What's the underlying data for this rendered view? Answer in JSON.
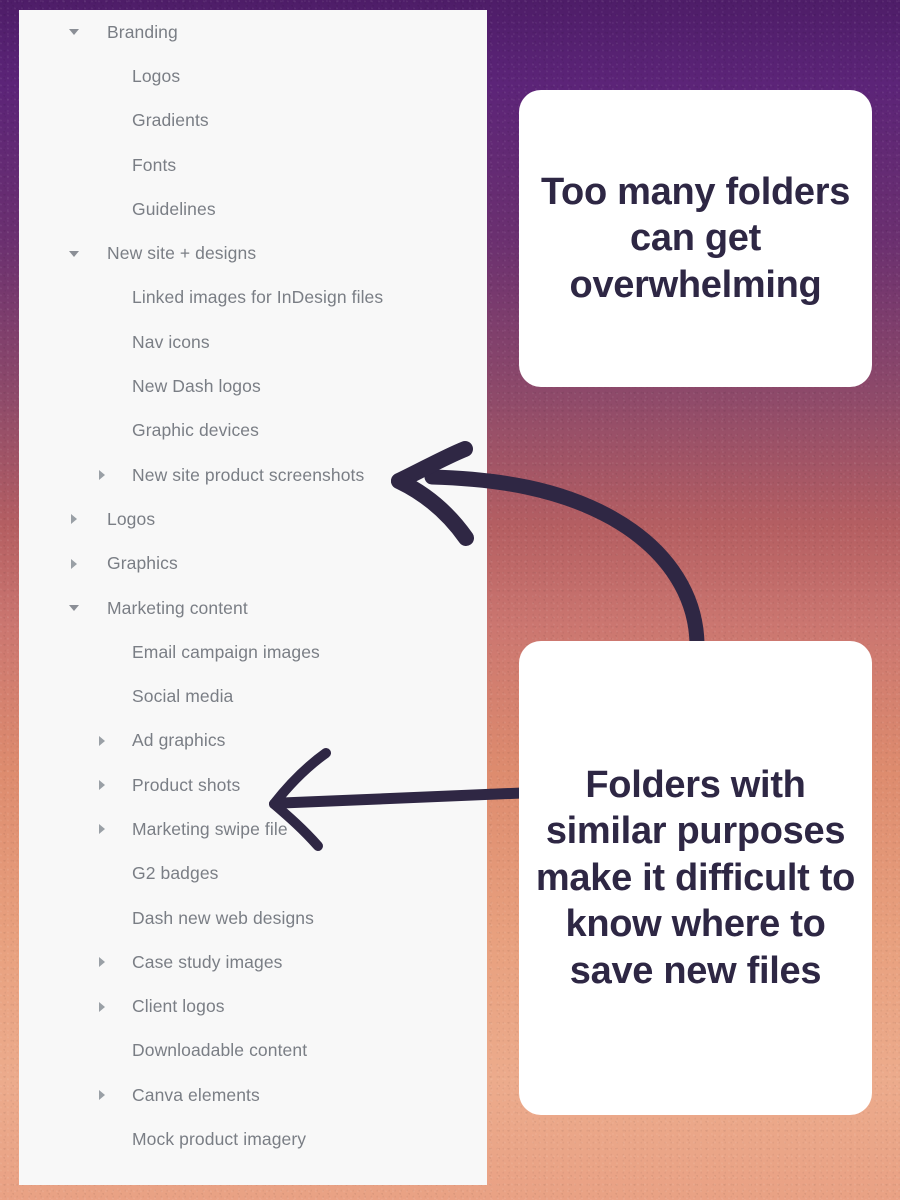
{
  "background": {
    "gradient_top_color": "#4e1d68",
    "gradient_mid_color": "#cb7670",
    "gradient_bottom_color": "#e9a184"
  },
  "panel": {
    "background_color": "#f8f8f8",
    "label_color": "#7a7e85"
  },
  "file_tree": {
    "items": [
      {
        "label": "Branding",
        "level": 1,
        "toggle": "expanded"
      },
      {
        "label": "Logos",
        "level": 2,
        "toggle": "none"
      },
      {
        "label": "Gradients",
        "level": 2,
        "toggle": "none"
      },
      {
        "label": "Fonts",
        "level": 2,
        "toggle": "none"
      },
      {
        "label": "Guidelines",
        "level": 2,
        "toggle": "none"
      },
      {
        "label": "New site + designs",
        "level": 1,
        "toggle": "expanded"
      },
      {
        "label": "Linked images for InDesign files",
        "level": 2,
        "toggle": "none"
      },
      {
        "label": "Nav icons",
        "level": 2,
        "toggle": "none"
      },
      {
        "label": "New Dash logos",
        "level": 2,
        "toggle": "none"
      },
      {
        "label": "Graphic devices",
        "level": 2,
        "toggle": "none"
      },
      {
        "label": "New site product screenshots",
        "level": 2,
        "toggle": "collapsed"
      },
      {
        "label": "Logos",
        "level": 1,
        "toggle": "collapsed"
      },
      {
        "label": "Graphics",
        "level": 1,
        "toggle": "collapsed"
      },
      {
        "label": "Marketing content",
        "level": 1,
        "toggle": "expanded"
      },
      {
        "label": "Email campaign images",
        "level": 2,
        "toggle": "none"
      },
      {
        "label": "Social media",
        "level": 2,
        "toggle": "none"
      },
      {
        "label": "Ad graphics",
        "level": 2,
        "toggle": "collapsed"
      },
      {
        "label": "Product shots",
        "level": 2,
        "toggle": "collapsed"
      },
      {
        "label": "Marketing swipe file",
        "level": 2,
        "toggle": "collapsed"
      },
      {
        "label": "G2 badges",
        "level": 2,
        "toggle": "none"
      },
      {
        "label": "Dash new web designs",
        "level": 2,
        "toggle": "none"
      },
      {
        "label": "Case study images",
        "level": 2,
        "toggle": "collapsed"
      },
      {
        "label": "Client logos",
        "level": 2,
        "toggle": "collapsed"
      },
      {
        "label": "Downloadable content",
        "level": 2,
        "toggle": "none"
      },
      {
        "label": "Canva elements",
        "level": 2,
        "toggle": "collapsed"
      },
      {
        "label": "Mock product imagery",
        "level": 2,
        "toggle": "none"
      }
    ]
  },
  "callouts": [
    {
      "id": "overwhelming",
      "text": "Too many folders can get overwhelming",
      "text_color": "#2e2744",
      "background_color": "#ffffff"
    },
    {
      "id": "similar-purposes",
      "text": "Folders with similar purposes make it difficult to know where to save new files",
      "text_color": "#2e2744",
      "background_color": "#ffffff"
    }
  ],
  "annotations": {
    "arrow_color": "#2f2744",
    "arrows": [
      {
        "name": "curved-arrow-to-new-site-product-screenshots",
        "style": "curved"
      },
      {
        "name": "straight-arrow-to-product-shots",
        "style": "straight"
      }
    ]
  }
}
